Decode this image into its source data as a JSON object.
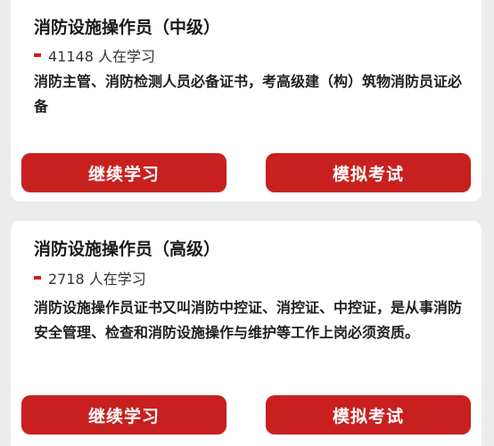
{
  "courses": [
    {
      "title": "消防设施操作员（中级）",
      "learners": "41148 人在学习",
      "description": "消防主管、消防检测人员必备证书，考高级建（构）筑物消防员证必备",
      "continue_label": "继续学习",
      "mock_exam_label": "模拟考试"
    },
    {
      "title": "消防设施操作员（高级）",
      "learners": "2718 人在学习",
      "description": "消防设施操作员证书又叫消防中控证、消控证、中控证，是从事消防安全管理、检查和消防设施操作与维护等工作上岗必须资质。",
      "continue_label": "继续学习",
      "mock_exam_label": "模拟考试"
    }
  ],
  "colors": {
    "accent": "#c8201e",
    "background": "#ececec",
    "card": "#ffffff"
  }
}
